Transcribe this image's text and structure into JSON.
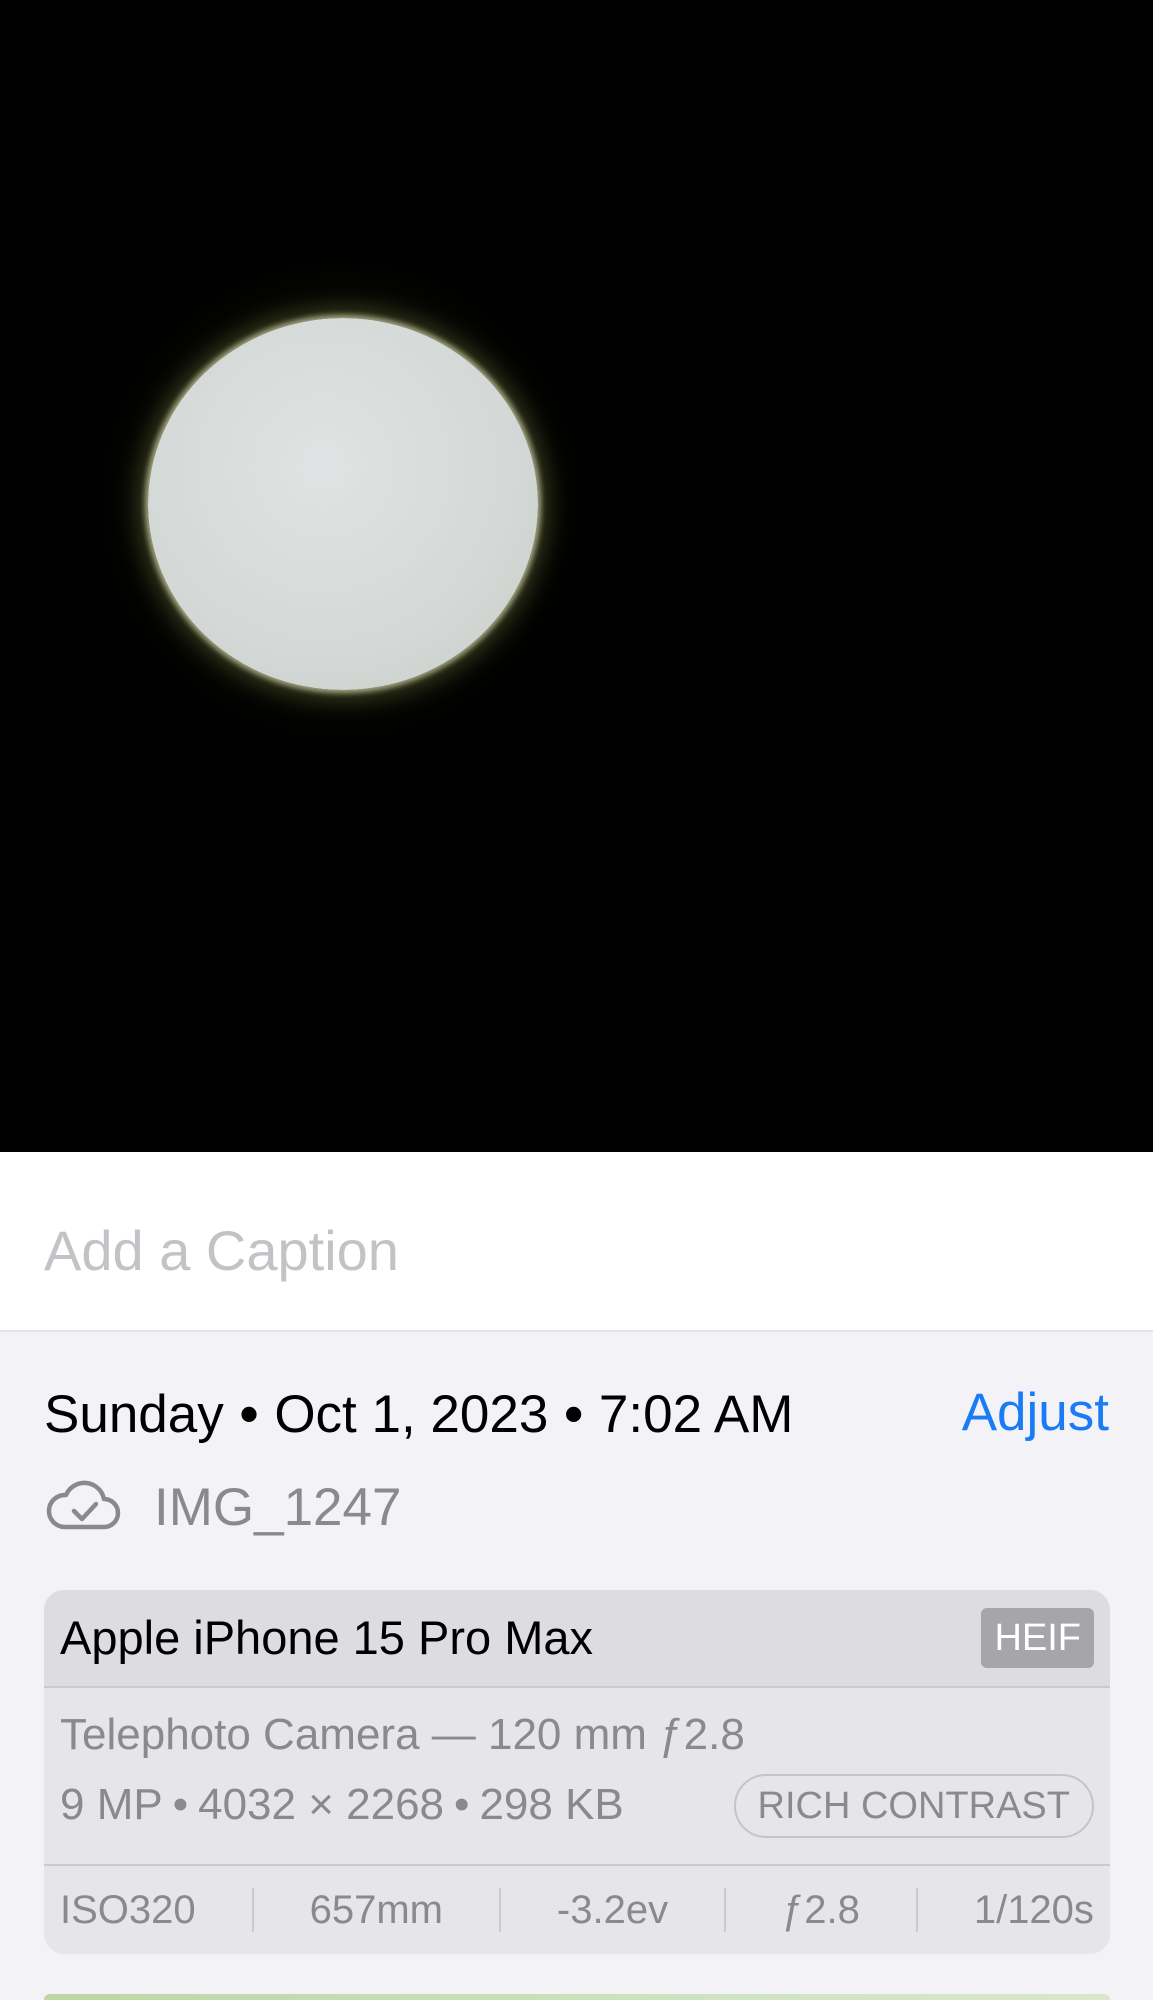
{
  "photo": {
    "subject_icon": "moon"
  },
  "caption": {
    "placeholder": "Add a Caption",
    "value": ""
  },
  "info": {
    "day": "Sunday",
    "date": "Oct 1, 2023",
    "time": "7:02 AM",
    "separator": "•",
    "adjust_label": "Adjust",
    "adjust_color": "#1a7cf5",
    "icloud_icon": "cloud-checkmark-icon",
    "filename": "IMG_1247"
  },
  "camera": {
    "device": "Apple iPhone 15 Pro Max",
    "format": "HEIF",
    "lens": "Telephoto Camera — 120 mm ƒ2.8",
    "megapixels": "9 MP",
    "resolution": "4032 × 2268",
    "file_size": "298 KB",
    "separator": "•",
    "style": "RICH CONTRAST",
    "exif": {
      "iso": "ISO320",
      "focal_length": "657mm",
      "exposure": "-3.2ev",
      "aperture": "ƒ2.8",
      "shutter": "1/120s"
    }
  }
}
